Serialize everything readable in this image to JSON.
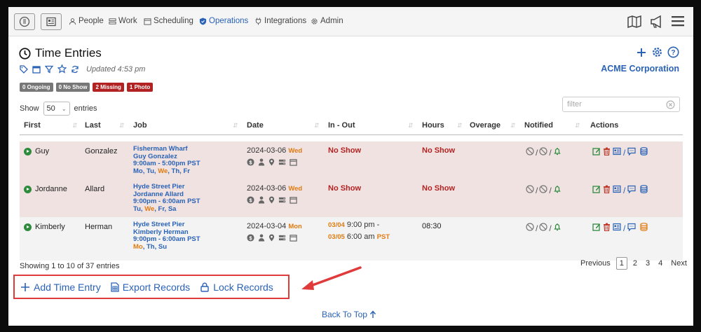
{
  "nav": {
    "items": [
      {
        "label": "People",
        "icon": "person-icon"
      },
      {
        "label": "Work",
        "icon": "work-icon"
      },
      {
        "label": "Scheduling",
        "icon": "calendar-icon"
      },
      {
        "label": "Operations",
        "icon": "shield-icon"
      },
      {
        "label": "Integrations",
        "icon": "plug-icon"
      },
      {
        "label": "Admin",
        "icon": "gear-icon"
      }
    ]
  },
  "page": {
    "title": "Time Entries",
    "updated": "Updated 4:53 pm",
    "company": "ACME Corporation"
  },
  "badges": [
    "0 Ongoing",
    "0 No Show",
    "2 Missing",
    "1 Photo"
  ],
  "table_controls": {
    "show_label": "Show",
    "entries_label": "entries",
    "length_value": "50",
    "filter_placeholder": "filter"
  },
  "columns": [
    "First",
    "Last",
    "Job",
    "Date",
    "In - Out",
    "Hours",
    "Overage",
    "Notified",
    "Actions"
  ],
  "rows": [
    {
      "first": "Guy",
      "last": "Gonzalez",
      "job": {
        "site": "Fisherman Wharf",
        "name": "Guy Gonzalez",
        "shift": "9:00am - 5:00pm PST",
        "days_pre": "Mo, Tu, ",
        "days_we": "We",
        "days_post": ", Th, Fr"
      },
      "date": "2024-03-06",
      "dow": "Wed",
      "in_out": "No Show",
      "hours": "No Show",
      "overage": "",
      "bg": "#efe2e1"
    },
    {
      "first": "Jordanne",
      "last": "Allard",
      "job": {
        "site": "Hyde Street Pier",
        "name": "Jordanne Allard",
        "shift": "9:00pm - 6:00am PST",
        "days_pre": "Tu, ",
        "days_we": "We",
        "days_post": ", Fr, Sa"
      },
      "date": "2024-03-06",
      "dow": "Wed",
      "in_out": "No Show",
      "hours": "No Show",
      "overage": "",
      "bg": "#efe2e1"
    },
    {
      "first": "Kimberly",
      "last": "Herman",
      "job": {
        "site": "Hyde Street Pier",
        "name": "Kimberly Herman",
        "shift": "9:00pm - 6:00am PST",
        "days_pre": "",
        "days_we": "Mo",
        "days_post": ", Th, Su"
      },
      "date": "2024-03-04",
      "dow": "Mon",
      "in_date": "03/04",
      "in_time": "9:00 pm -",
      "out_date": "03/05",
      "out_time": "6:00 am",
      "out_tz": "PST",
      "hours": "08:30",
      "overage": "",
      "bg": "#f3f3f3"
    }
  ],
  "footer": {
    "showing": "Showing 1 to 10 of 37 entries",
    "previous": "Previous",
    "pages": [
      "1",
      "2",
      "3",
      "4"
    ],
    "next": "Next"
  },
  "actions": {
    "add": "Add Time Entry",
    "export": "Export Records",
    "lock": "Lock Records"
  },
  "back_to_top": "Back To Top",
  "colors": {
    "accent": "#2a62b6",
    "danger": "#b22222",
    "highlight": "#e03b3b",
    "orange": "#e07b12",
    "green": "#2e8b3e"
  }
}
